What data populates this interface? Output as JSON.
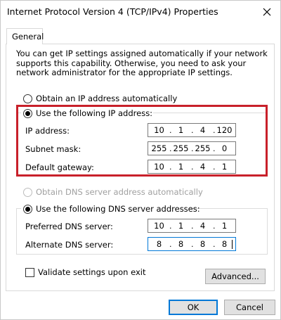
{
  "window": {
    "title": "Internet Protocol Version 4 (TCP/IPv4) Properties"
  },
  "tabs": [
    {
      "label": "General"
    }
  ],
  "intro": "You can get IP settings assigned automatically if your network supports this capability. Otherwise, you need to ask your network administrator for the appropriate IP settings.",
  "ip": {
    "auto_label": "Obtain an IP address automatically",
    "manual_label": "Use the following IP address:",
    "selected": "manual",
    "fields": [
      {
        "label": "IP address:",
        "octets": [
          "10",
          "1",
          "4",
          "120"
        ]
      },
      {
        "label": "Subnet mask:",
        "octets": [
          "255",
          "255",
          "255",
          "0"
        ]
      },
      {
        "label": "Default gateway:",
        "octets": [
          "10",
          "1",
          "4",
          "1"
        ]
      }
    ]
  },
  "dns": {
    "auto_label": "Obtain DNS server address automatically",
    "manual_label": "Use the following DNS server addresses:",
    "selected": "manual",
    "fields": [
      {
        "label": "Preferred DNS server:",
        "octets": [
          "10",
          "1",
          "4",
          "1"
        ]
      },
      {
        "label": "Alternate DNS server:",
        "octets": [
          "8",
          "8",
          "8",
          "8"
        ]
      }
    ]
  },
  "validate": {
    "label": "Validate settings upon exit",
    "checked": false
  },
  "buttons": {
    "advanced": "Advanced...",
    "ok": "OK",
    "cancel": "Cancel"
  },
  "colors": {
    "highlight": "#c8202a",
    "focus": "#0078d7"
  }
}
